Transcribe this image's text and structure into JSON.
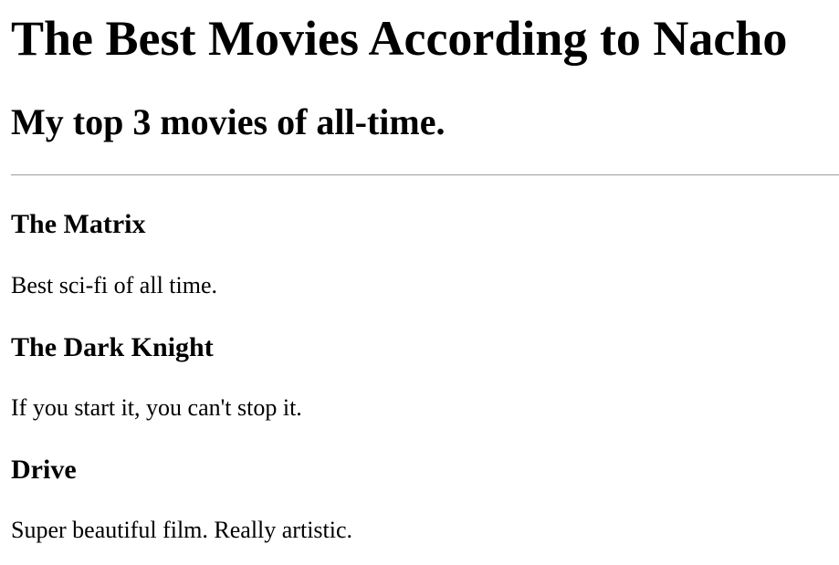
{
  "header": {
    "title": "The Best Movies According to Nacho",
    "subtitle": "My top 3 movies of all-time."
  },
  "movies": [
    {
      "title": "The Matrix",
      "description": "Best sci-fi of all time."
    },
    {
      "title": "The Dark Knight",
      "description": "If you start it, you can't stop it."
    },
    {
      "title": "Drive",
      "description": "Super beautiful film. Really artistic."
    }
  ],
  "colors": {
    "background": "#ffffff",
    "text": "#000000",
    "divider": "#a8a8a8"
  }
}
